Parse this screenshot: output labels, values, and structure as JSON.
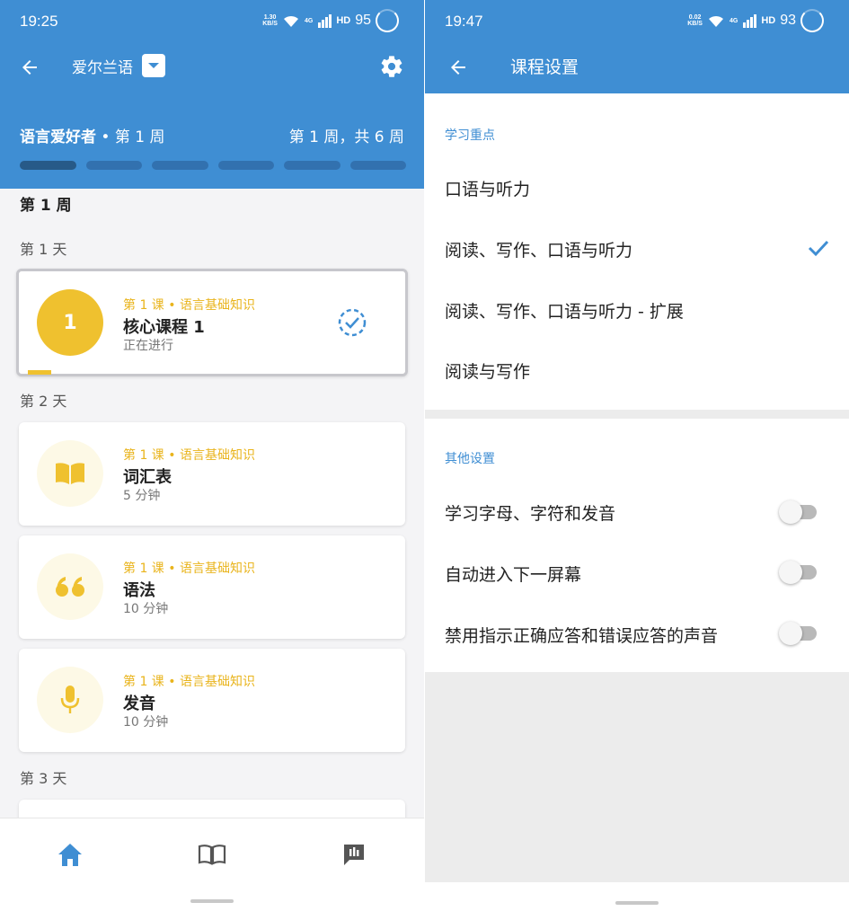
{
  "left": {
    "status": {
      "time": "19:25",
      "speed_top": "1.30",
      "speed_unit": "KB/S",
      "net": "4G",
      "hd": "HD",
      "battery": "95"
    },
    "header": {
      "language": "爱尔兰语",
      "level_name": "语言爱好者",
      "level_week": " • 第 1 周",
      "week_count": "第 1 周，共 6 周",
      "total_weeks": 6,
      "current_week": 1
    },
    "week_title": "第 1 周",
    "days": [
      {
        "label": "第 1 天"
      },
      {
        "label": "第 2 天"
      },
      {
        "label": "第 3 天"
      }
    ],
    "cards": [
      {
        "number": "1",
        "subtitle": "第 1 课 • 语言基础知识",
        "title": "核心课程 1",
        "meta": "正在进行",
        "icon": "number-circle"
      },
      {
        "subtitle": "第 1 课 • 语言基础知识",
        "title": "词汇表",
        "meta": "5 分钟",
        "icon": "book-icon"
      },
      {
        "subtitle": "第 1 课 • 语言基础知识",
        "title": "语法",
        "meta": "10 分钟",
        "icon": "quote-icon"
      },
      {
        "subtitle": "第 1 课 • 语言基础知识",
        "title": "发音",
        "meta": "10 分钟",
        "icon": "microphone-icon"
      }
    ],
    "nav": [
      "home-icon",
      "library-icon",
      "feedback-icon"
    ]
  },
  "right": {
    "status": {
      "time": "19:47",
      "speed_top": "0.02",
      "speed_unit": "KB/S",
      "net": "4G",
      "hd": "HD",
      "battery": "93"
    },
    "title": "课程设置",
    "focus_section": "学习重点",
    "focus_options": [
      {
        "label": "口语与听力",
        "selected": false
      },
      {
        "label": "阅读、写作、口语与听力",
        "selected": true
      },
      {
        "label": "阅读、写作、口语与听力 - 扩展",
        "selected": false
      },
      {
        "label": "阅读与写作",
        "selected": false
      }
    ],
    "other_section": "其他设置",
    "other_options": [
      {
        "label": "学习字母、字符和发音",
        "on": false
      },
      {
        "label": "自动进入下一屏幕",
        "on": false
      },
      {
        "label": "禁用指示正确应答和错误应答的声音",
        "on": false
      }
    ]
  },
  "colors": {
    "primary": "#3f8ed3",
    "accent": "#efc12f",
    "toggle_off": "#b9b9b9"
  }
}
